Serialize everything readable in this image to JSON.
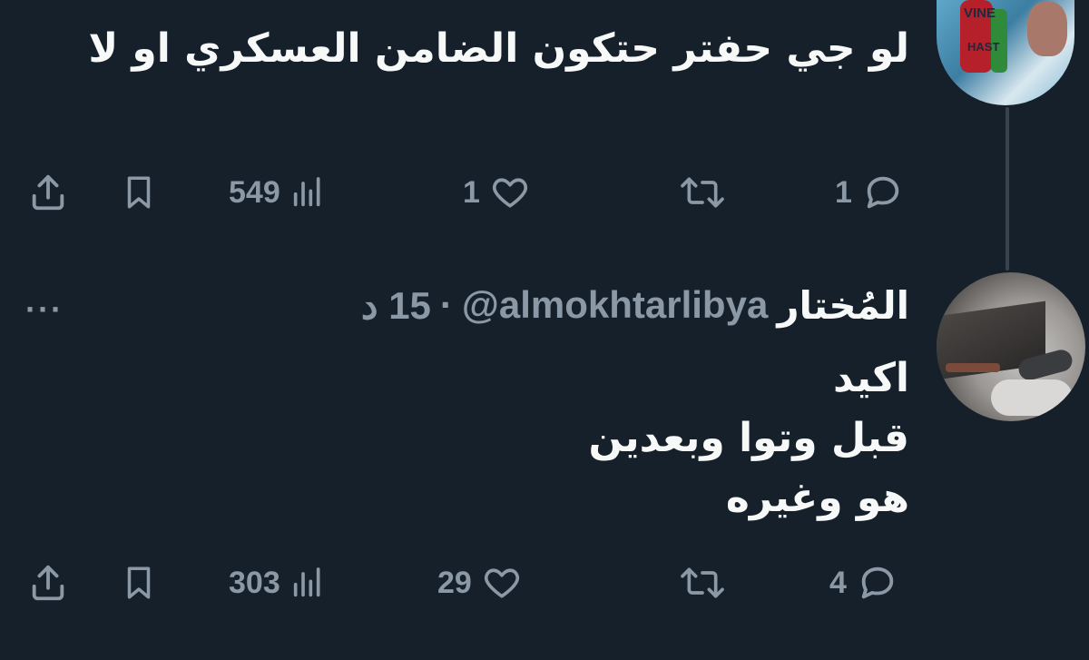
{
  "tweet1": {
    "text": "لو جي حفتر حتكون الضامن العسكري او لا",
    "actions": {
      "replies": "1",
      "retweets": "",
      "likes": "1",
      "views": "549"
    }
  },
  "tweet2": {
    "display_name": "المُختار",
    "handle": "@almokhtarlibya",
    "separator": "·",
    "time": "15 د",
    "more": "···",
    "lines": [
      "اكيد",
      "قبل وتوا وبعدين",
      "هو وغيره"
    ],
    "actions": {
      "replies": "4",
      "retweets": "",
      "likes": "29",
      "views": "303"
    }
  },
  "avatar1": {
    "text_top": "VINE",
    "text_mid": "HAST"
  },
  "icons": {
    "reply": "reply-icon",
    "retweet": "retweet-icon",
    "like": "heart-icon",
    "views": "views-icon",
    "bookmark": "bookmark-icon",
    "share": "share-icon"
  },
  "colors": {
    "background": "#15202b",
    "text": "#f7f9f9",
    "muted": "#8b98a5",
    "thread_line": "#38444d"
  }
}
